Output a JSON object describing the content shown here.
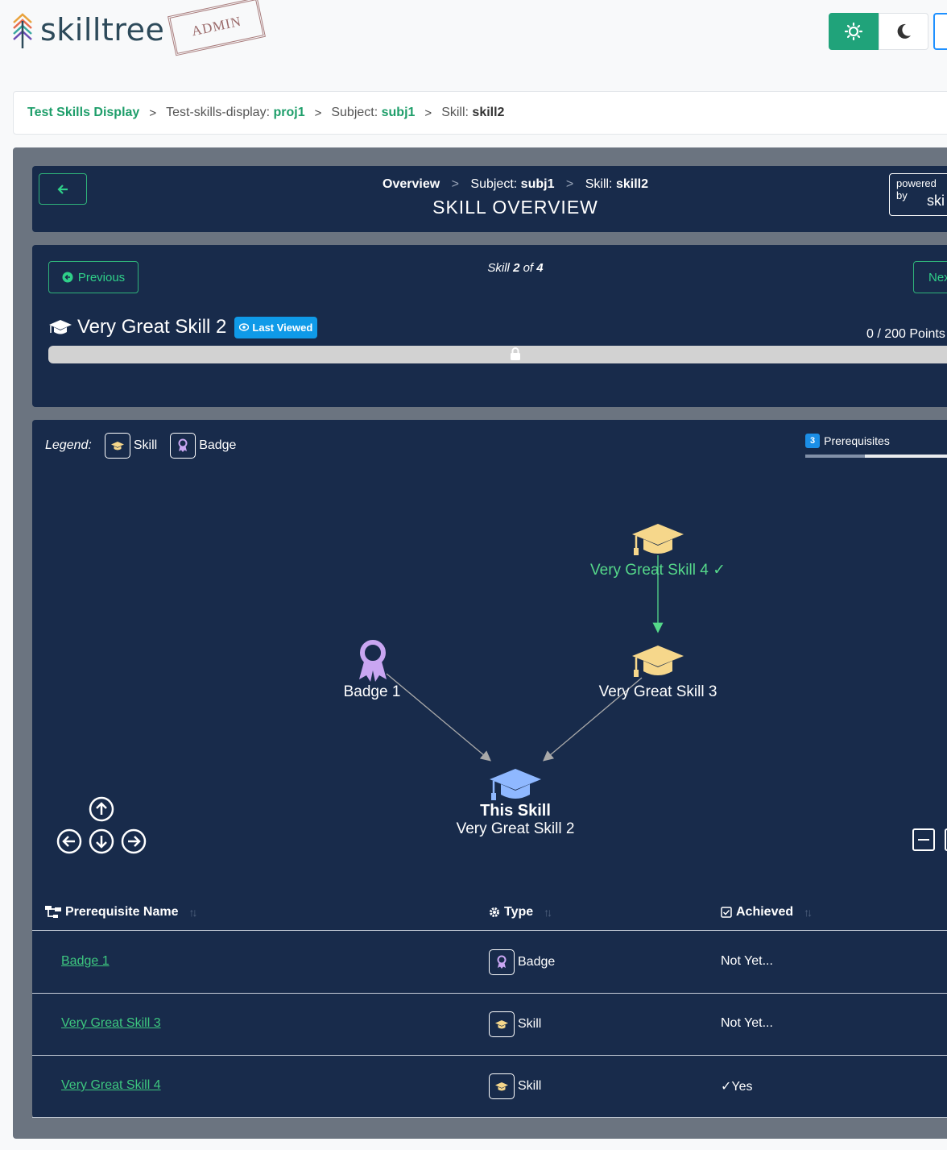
{
  "header": {
    "logo_text": "skilltree",
    "stamp_text": "ADMIN",
    "theme": {
      "light_icon": "sun-icon",
      "dark_icon": "moon-icon",
      "accent": "#20a37a"
    }
  },
  "breadcrumb": {
    "root": "Test Skills Display",
    "project_label": "Test-skills-display:",
    "project_value": "proj1",
    "subject_label": "Subject:",
    "subject_value": "subj1",
    "skill_label": "Skill:",
    "skill_value": "skill2"
  },
  "skills_display": {
    "nav": {
      "overview": "Overview",
      "subject_label": "Subject:",
      "subject_value": "subj1",
      "skill_label": "Skill:",
      "skill_value": "skill2"
    },
    "title": "SKILL OVERVIEW",
    "powered_by": "powered by",
    "powered_brand": "ski"
  },
  "skill": {
    "previous_label": "Previous",
    "next_label": "Nex",
    "count_prefix": "Skill",
    "count_current": "2",
    "count_of": "of",
    "count_total": "4",
    "name": "Very Great Skill 2",
    "last_viewed": "Last Viewed",
    "points": "0 / 200 Points",
    "progress": 0
  },
  "graph": {
    "legend_label": "Legend:",
    "legend_skill": "Skill",
    "legend_badge": "Badge",
    "prereq_count": "3",
    "prereq_label": "Prerequisites",
    "nodes": {
      "skill4": "Very Great Skill 4 ✓",
      "skill3": "Very Great Skill 3",
      "badge1": "Badge 1",
      "this_title": "This Skill",
      "this_name": "Very Great Skill 2"
    }
  },
  "table": {
    "col_name": "Prerequisite Name",
    "col_type": "Type",
    "col_achieved": "Achieved",
    "rows": [
      {
        "name": "Badge 1",
        "type": "Badge",
        "achieved": "Not Yet..."
      },
      {
        "name": "Very Great Skill 3",
        "type": "Skill",
        "achieved": "Not Yet..."
      },
      {
        "name": "Very Great Skill 4",
        "type": "Skill",
        "achieved": "✓Yes"
      }
    ]
  }
}
